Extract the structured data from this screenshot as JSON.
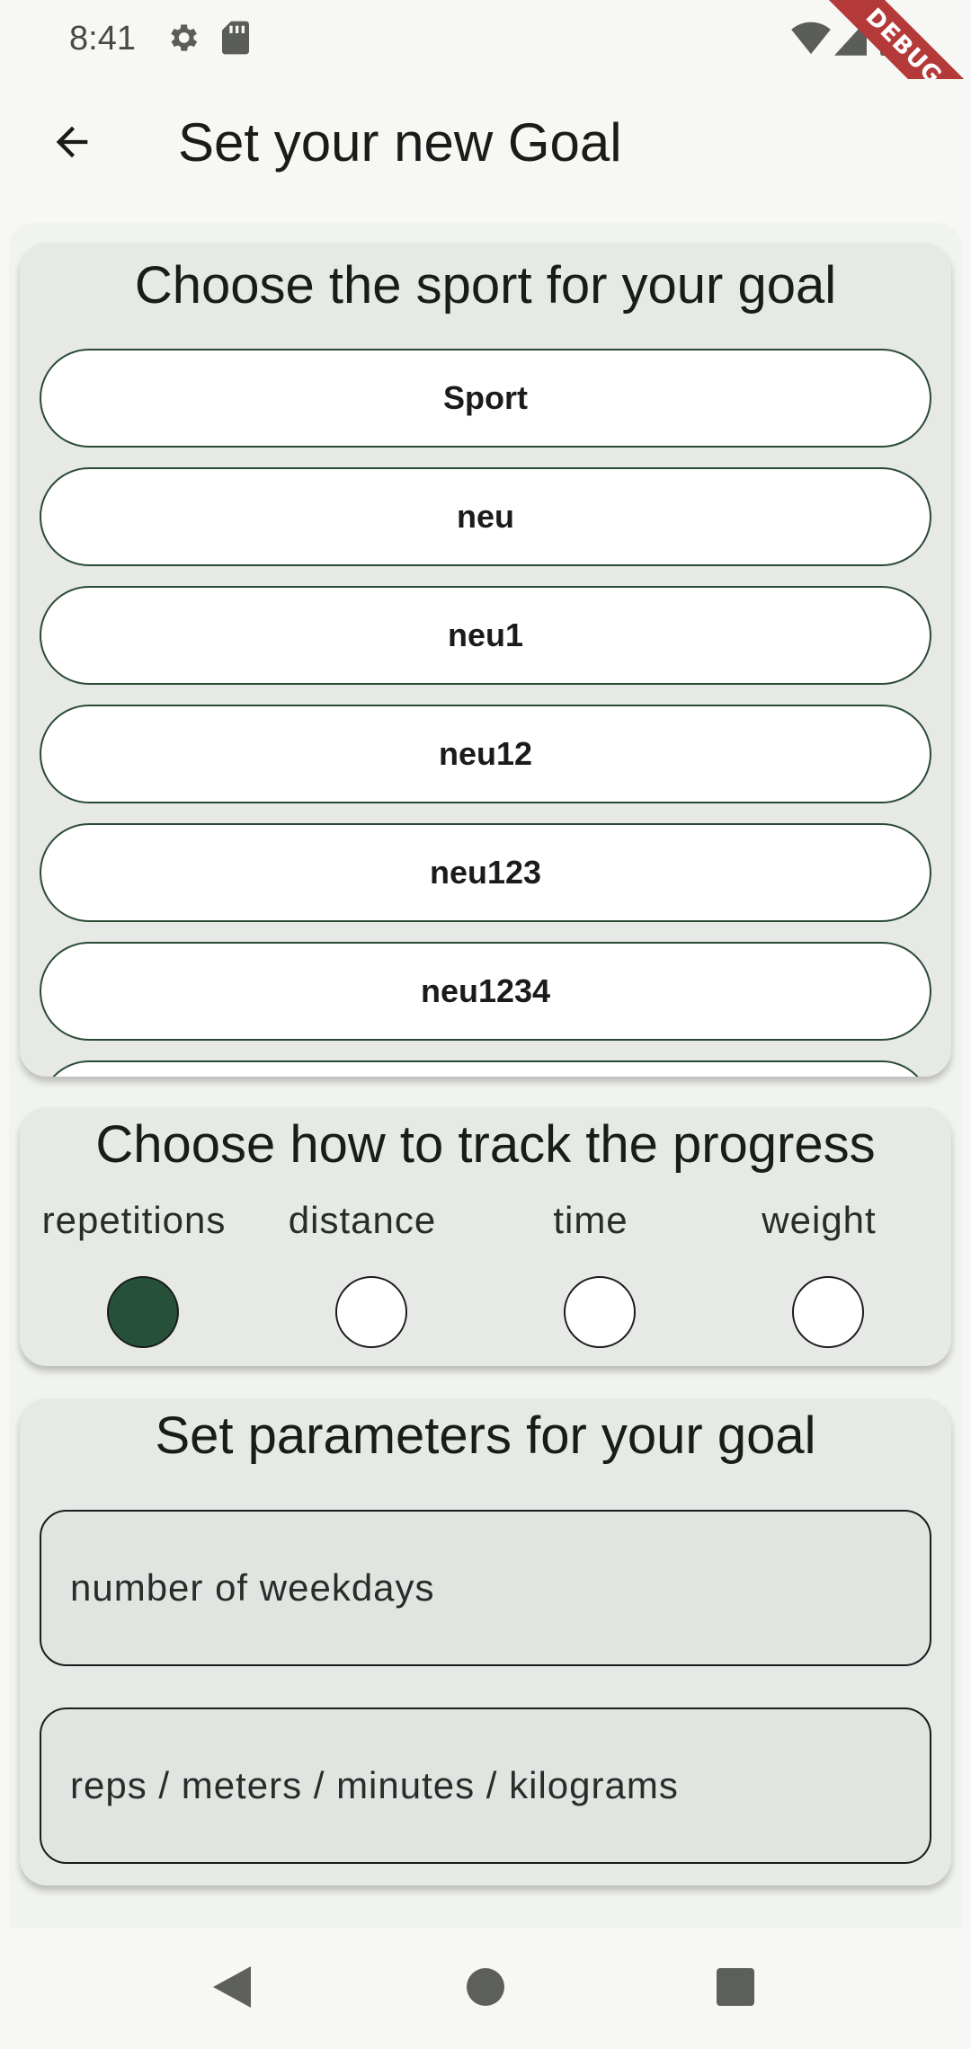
{
  "status_bar": {
    "time": "8:41",
    "icons": [
      "gear-icon",
      "sd-card-icon",
      "wifi-icon",
      "signal-icon",
      "battery-icon"
    ],
    "debug_banner": "DEBUG"
  },
  "app_bar": {
    "back_icon": "arrow-left-icon",
    "title": "Set your new Goal"
  },
  "sport_section": {
    "title": "Choose the sport for your goal",
    "sports": [
      "Sport",
      "neu",
      "neu1",
      "neu12",
      "neu123",
      "neu1234",
      ""
    ]
  },
  "track_section": {
    "title": "Choose how to track the progress",
    "options": [
      {
        "label": "repetitions",
        "selected": true
      },
      {
        "label": "distance",
        "selected": false
      },
      {
        "label": "time",
        "selected": false
      },
      {
        "label": "weight",
        "selected": false
      }
    ]
  },
  "params_section": {
    "title": "Set parameters for your goal",
    "weekdays_placeholder": "number of weekdays",
    "amount_placeholder": "reps / meters / minutes / kilograms"
  },
  "nav_bar": {
    "icons": [
      "back-triangle-icon",
      "home-circle-icon",
      "recents-square-icon"
    ]
  },
  "colors": {
    "accent": "#27503a",
    "card_bg": "#e6e9e6",
    "page_bg": "#f7f8f6",
    "debug_ribbon": "#b43a3a"
  }
}
